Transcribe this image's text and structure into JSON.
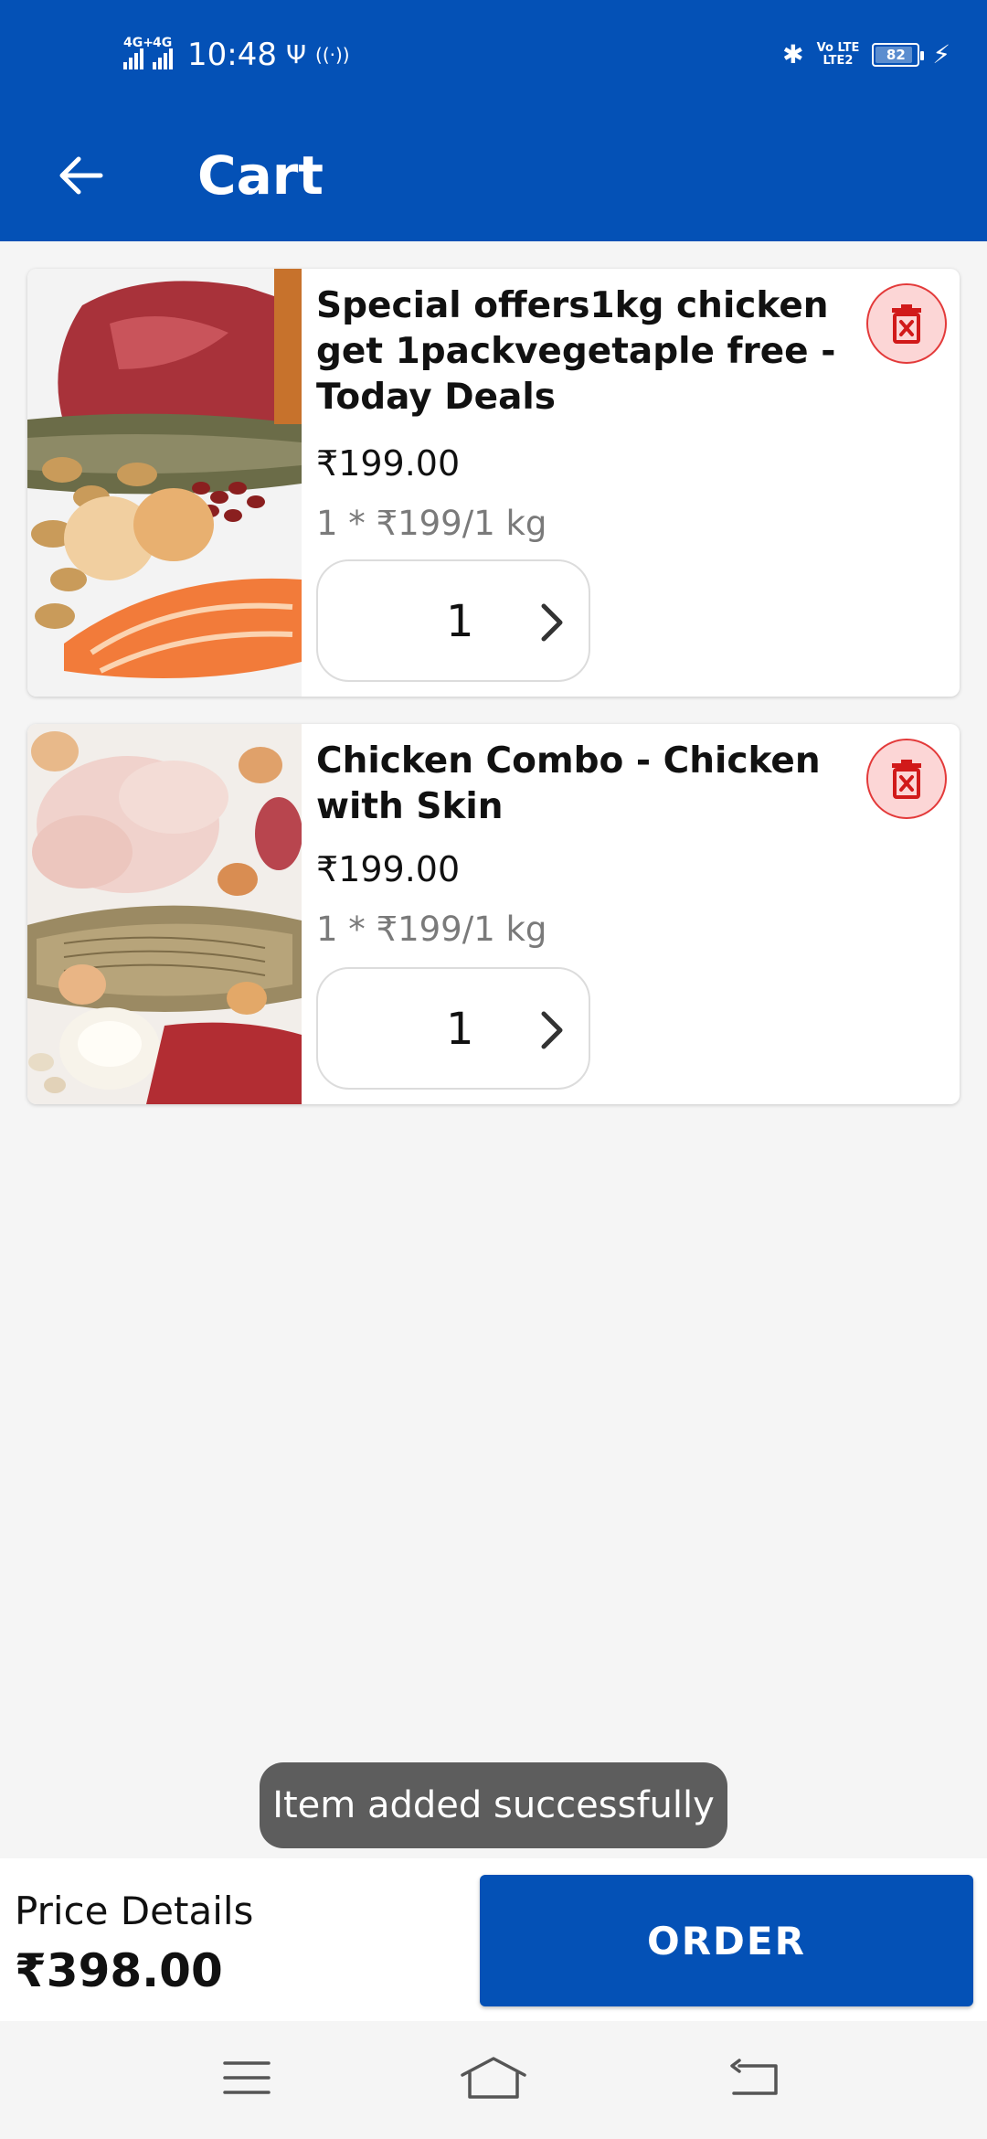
{
  "status_bar": {
    "network_1": "4G+",
    "network_2": "4G",
    "time": "10:48",
    "usb_symbol": "Ψ",
    "hotspot_symbol": "((·))",
    "bluetooth_symbol": "✱",
    "volte_top": "Vo LTE",
    "volte_bottom": "LTE2",
    "battery_level": "82",
    "battery_fraction": 0.82,
    "charging_symbol": "⚡"
  },
  "app_bar": {
    "title": "Cart",
    "back_icon": "arrow-left-icon",
    "background": "#0451b6"
  },
  "cart_items": [
    {
      "name": "Special offers1kg chicken get 1packvegetaple free - Today Deals",
      "price": "₹199.00",
      "unit": "1 * ₹199/1 kg",
      "quantity": "1",
      "image": "meat-fish-eggs-photo",
      "delete_icon": "trash-icon"
    },
    {
      "name": "Chicken Combo - Chicken with Skin",
      "price": "₹199.00",
      "unit": "1 * ₹199/1 kg",
      "quantity": "1",
      "image": "chicken-fish-eggs-photo",
      "delete_icon": "trash-icon"
    }
  ],
  "toast": {
    "message": "Item added successfully"
  },
  "footer": {
    "price_label": "Price Details",
    "total": "₹398.00",
    "order_label": "ORDER",
    "order_color": "#0451b6"
  },
  "nav_bar": {
    "menu_icon": "menu-icon",
    "home_icon": "home-icon",
    "back_icon": "back-icon"
  },
  "colors": {
    "primary": "#0451b6",
    "delete_bg": "#fcd6d6",
    "delete_icon": "#d11a1a",
    "muted_text": "#7a7a7a"
  }
}
